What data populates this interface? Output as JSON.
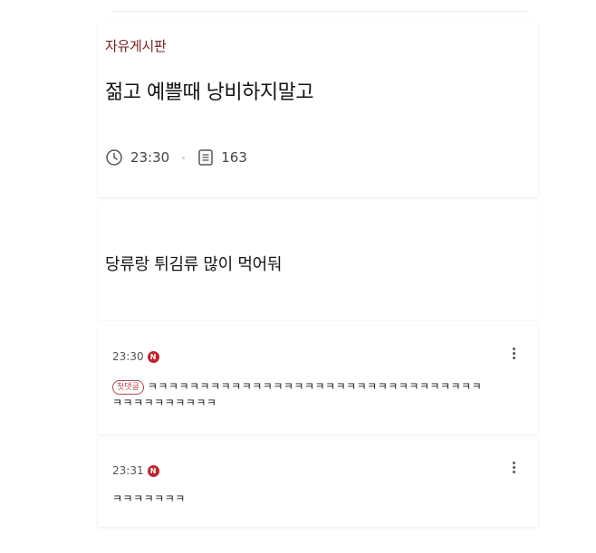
{
  "post": {
    "board": "자유게시판",
    "title": "젊고 예쁠때 낭비하지말고",
    "time": "23:30",
    "views": "163",
    "body": "당류랑 튀김류 많이 먹어둬"
  },
  "comments": [
    {
      "time": "23:30",
      "badge": "N",
      "tag": "첫댓글",
      "text": "ㅋㅋㅋㅋㅋㅋㅋㅋㅋㅋㅋㅋㅋㅋㅋㅋㅋㅋㅋㅋㅋㅋㅋㅋㅋㅋㅋㅋㅋㅋㅋㅋㅋㅋㅋㅋㅋㅋㅋㅋㅋㅋ"
    },
    {
      "time": "23:31",
      "badge": "N",
      "text": "ㅋㅋㅋㅋㅋㅋㅋ"
    }
  ],
  "colors": {
    "board": "#7a1d22",
    "badge": "#c0242c"
  }
}
